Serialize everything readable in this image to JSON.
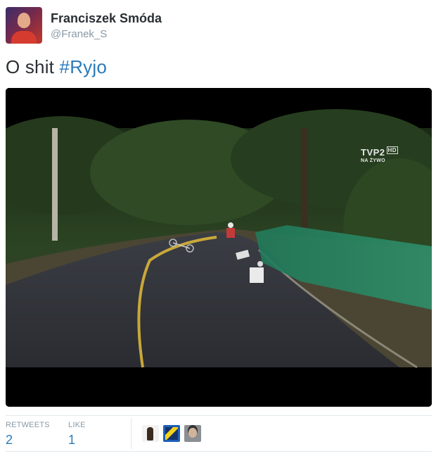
{
  "author": {
    "name": "Franciszek Smóda",
    "handle": "@Franek_S"
  },
  "tweet": {
    "text": "O shit ",
    "hashtag": "#Ryjo"
  },
  "media": {
    "broadcaster_logo": "TVP2",
    "broadcaster_hd": "HD",
    "broadcaster_live": "NA ŻYWO"
  },
  "stats": {
    "retweets_label": "RETWEETS",
    "retweets_value": "2",
    "likes_label": "LIKE",
    "likes_value": "1"
  },
  "colors": {
    "link": "#2b7bb9",
    "muted": "#8899a6",
    "text": "#292f33"
  }
}
